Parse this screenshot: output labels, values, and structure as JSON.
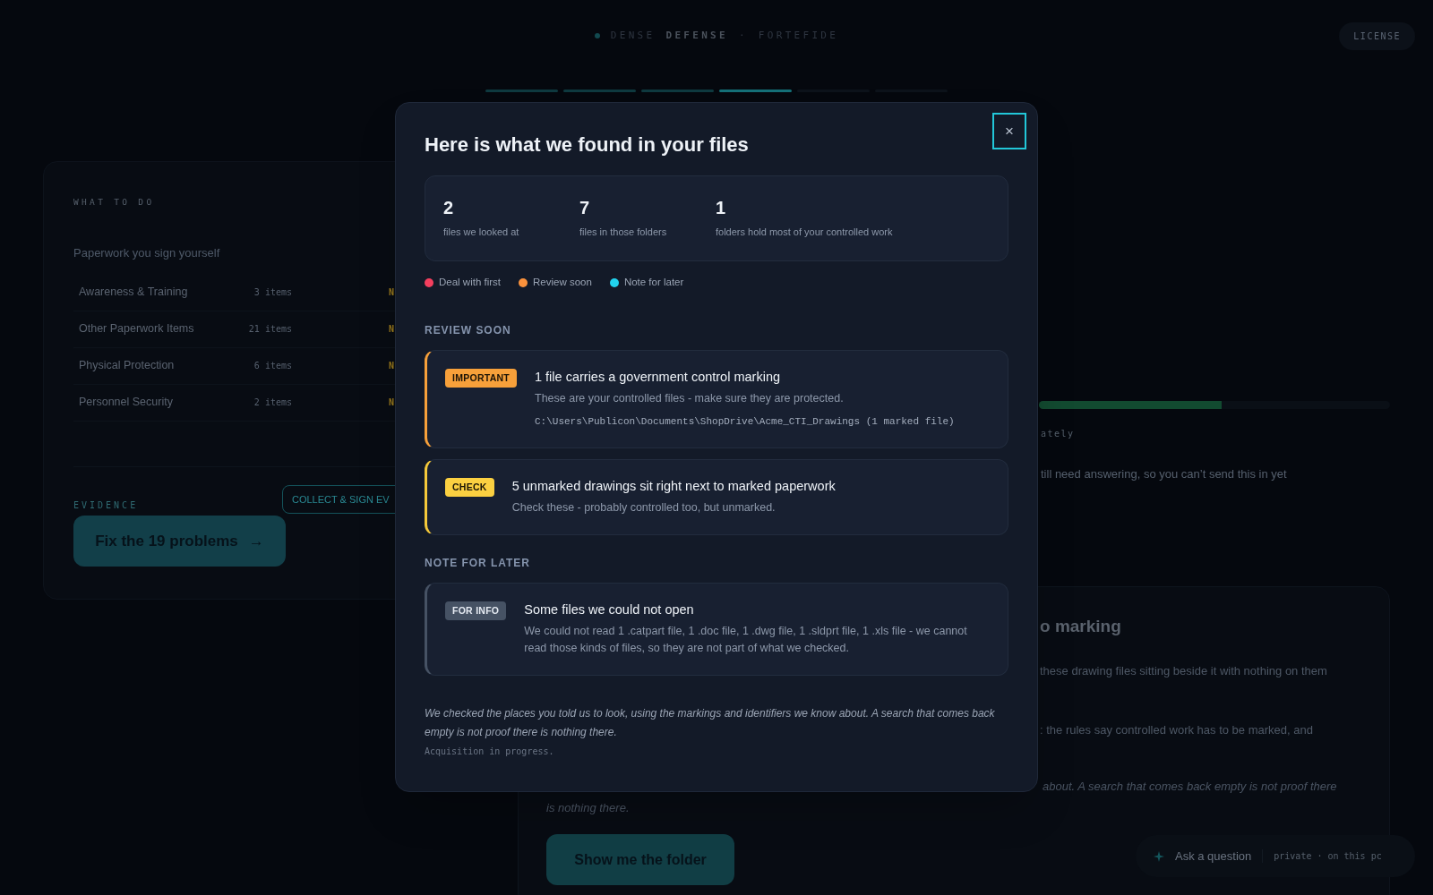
{
  "brand": {
    "parts": [
      {
        "text": "DENSE",
        "kind": "light"
      },
      {
        "text": "DEFENSE",
        "kind": "bold"
      },
      {
        "text": "·",
        "kind": "light"
      },
      {
        "text": "FORTEFIDE",
        "kind": "light"
      }
    ]
  },
  "license_button": "LICENSE",
  "steps": [
    {
      "done": true,
      "selected": false
    },
    {
      "done": true,
      "selected": false
    },
    {
      "done": true,
      "selected": false
    },
    {
      "done": true,
      "selected": true
    },
    {
      "done": false,
      "selected": false
    },
    {
      "done": false,
      "selected": false
    }
  ],
  "left_panel": {
    "heading": "WHAT TO DO",
    "group_title": "Paperwork you sign yourself",
    "rows": [
      {
        "name": "Awareness & Training",
        "count": "3 items",
        "status": "N"
      },
      {
        "name": "Other Paperwork Items",
        "count": "21 items",
        "status": "N"
      },
      {
        "name": "Physical Protection",
        "count": "6 items",
        "status": "N"
      },
      {
        "name": "Personnel Security",
        "count": "2 items",
        "status": "N"
      }
    ],
    "evidence_label": "EVIDENCE",
    "collect_button": "COLLECT & SIGN EV",
    "fix_button": "Fix the 19 problems",
    "fix_arrow": "→"
  },
  "right_column": {
    "progress": {
      "level": 0.52
    },
    "progress_note": "ately",
    "status_text": "till need answering, so you can’t send this in yet",
    "card": {
      "heading": "o marking",
      "lines": [
        "these drawing files sitting beside it with nothing on them",
        ": the rules say controlled work has to be marked, and"
      ],
      "italic_line": "about. A search that comes back empty is not proof there",
      "italic_wrap": "is nothing there.",
      "button": "Show me the folder"
    }
  },
  "assistant": {
    "label": "Ask a question",
    "note": "private · on this pc"
  },
  "modal": {
    "title": "Here is what we found in your files",
    "close": "×",
    "stats": [
      {
        "value": "2",
        "label": "files we looked at"
      },
      {
        "value": "7",
        "label": "files in those folders"
      },
      {
        "value": "1",
        "label": "folders hold most of your controlled work"
      }
    ],
    "legend": [
      {
        "label": "Deal with first",
        "color": "#f43f5e"
      },
      {
        "label": "Review soon",
        "color": "#fb923c"
      },
      {
        "label": "Note for later",
        "color": "#22d3ee"
      }
    ],
    "sections": [
      {
        "heading": "REVIEW SOON",
        "findings": [
          {
            "kind": "important",
            "badge": "IMPORTANT",
            "title": "1 file carries a government control marking",
            "body": "These are your controlled files - make sure they are protected.",
            "path": "C:\\Users\\Publicon\\Documents\\ShopDrive\\Acme_CTI_Drawings (1 marked file)"
          },
          {
            "kind": "check",
            "badge": "CHECK",
            "title": "5 unmarked drawings sit right next to marked paperwork",
            "body": "Check these - probably controlled too, but unmarked."
          }
        ]
      },
      {
        "heading": "NOTE FOR LATER",
        "findings": [
          {
            "kind": "info",
            "badge": "FOR INFO",
            "title": "Some files we could not open",
            "body": "We could not read 1 .catpart file, 1 .doc file, 1 .dwg file, 1 .sldprt file, 1 .xls file - we cannot read those kinds of files, so they are not part of what we checked."
          }
        ]
      }
    ],
    "footer_note": "We checked the places you told us to look, using the markings and identifiers we know about. A search that comes back empty is not proof there is nothing there.",
    "status": "Acquisition in progress."
  }
}
